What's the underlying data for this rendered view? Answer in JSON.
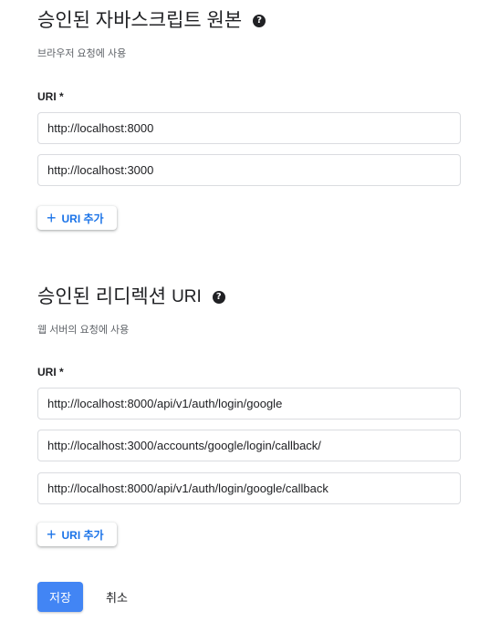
{
  "origins": {
    "title": "승인된 자바스크립트 원본",
    "description": "브라우저 요청에 사용",
    "field_label": "URI *",
    "uris": [
      "http://localhost:8000",
      "http://localhost:3000"
    ],
    "add_button": {
      "icon_text": "+",
      "label": "URI 추가"
    },
    "help_icon_text": "?"
  },
  "redirects": {
    "title_prefix": "승인된 리디렉션",
    "title_suffix": "URI",
    "description": "웹 서버의 요청에 사용",
    "field_label": "URI *",
    "uris": [
      "http://localhost:8000/api/v1/auth/login/google",
      "http://localhost:3000/accounts/google/login/callback/",
      "http://localhost:8000/api/v1/auth/login/google/callback"
    ],
    "add_button": {
      "icon_text": "+",
      "label": "URI 추가"
    },
    "help_icon_text": "?"
  },
  "actions": {
    "save_label": "저장",
    "cancel_label": "취소"
  },
  "colors": {
    "accent": "#1a73e8",
    "primary_button": "#4285f4",
    "border": "#dadce0",
    "secondary_text": "#5f6368"
  }
}
